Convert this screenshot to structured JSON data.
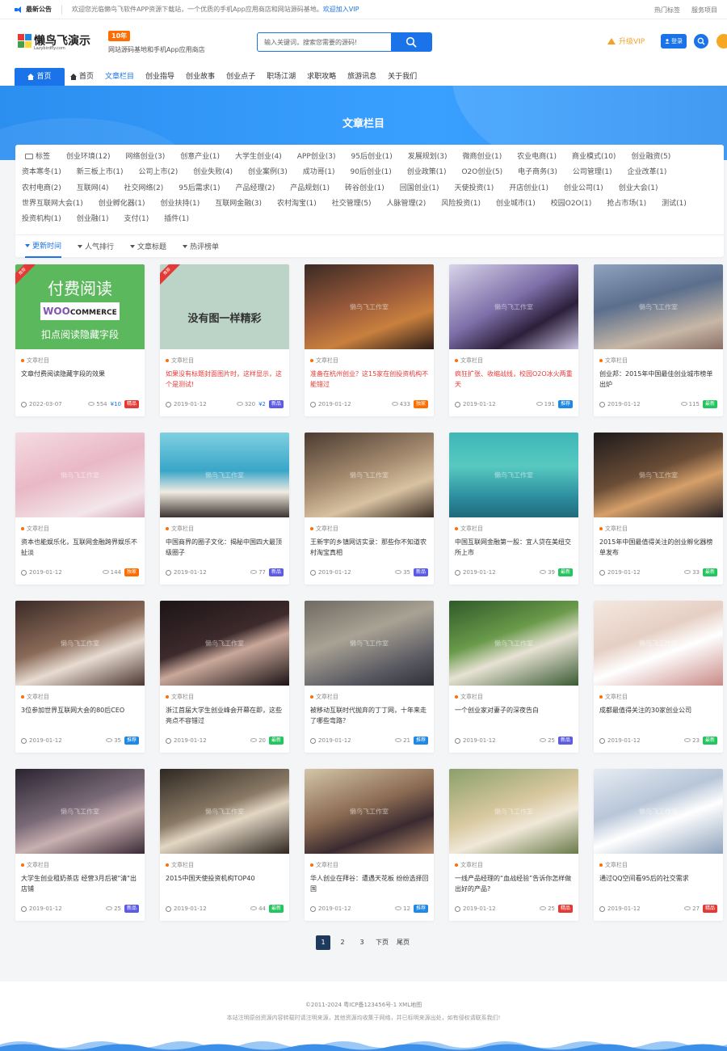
{
  "notice": {
    "title": "最新公告",
    "text": "欢迎您光临懒鸟飞软件APP资源下载站，一个优质的手机App应用商店和网站源码基地。",
    "link": "欢迎加入VIP",
    "right_links": [
      "热门标签",
      "服务项目"
    ]
  },
  "header": {
    "logo_text": "懒鸟飞演示",
    "logo_sub": "Lazybirdfly.com",
    "years_badge": "10年",
    "slogan": "网站源码基地和手机App应用商店",
    "search_placeholder": "输入关键词，搜索您需要的源码!",
    "vip_label": "升级VIP",
    "login_label": "登录"
  },
  "nav": {
    "items": [
      {
        "label": "首页",
        "home": true
      },
      {
        "label": "首页",
        "icon": true
      },
      {
        "label": "文章栏目",
        "active": true
      },
      {
        "label": "创业指导"
      },
      {
        "label": "创业故事"
      },
      {
        "label": "创业点子"
      },
      {
        "label": "职场江湖"
      },
      {
        "label": "求职攻略"
      },
      {
        "label": "旅游讯息"
      },
      {
        "label": "关于我们"
      }
    ]
  },
  "banner": {
    "title": "文章栏目"
  },
  "tags": {
    "head": "标签",
    "items": [
      "创业环境(12)",
      "网络创业(3)",
      "创意产业(1)",
      "大学生创业(4)",
      "APP创业(3)",
      "95后创业(1)",
      "发展规划(3)",
      "微商创业(1)",
      "农业电商(1)",
      "商业模式(10)",
      "创业融资(5)",
      "资本寒冬(1)",
      "新三板上市(1)",
      "公司上市(2)",
      "创业失败(4)",
      "创业案例(3)",
      "成功哥(1)",
      "90后创业(1)",
      "创业政策(1)",
      "O2O创业(5)",
      "电子商务(3)",
      "公司管理(1)",
      "企业改革(1)",
      "农村电商(2)",
      "互联网(4)",
      "社交网络(2)",
      "95后需求(1)",
      "产品经理(2)",
      "产品规划(1)",
      "砖谷创业(1)",
      "回国创业(1)",
      "天使投资(1)",
      "开店创业(1)",
      "创业公司(1)",
      "创业大会(1)",
      "世界互联网大会(1)",
      "创业孵化器(1)",
      "创业扶持(1)",
      "互联网金融(3)",
      "农村淘宝(1)",
      "社交管理(5)",
      "人脉管理(2)",
      "风险投资(1)",
      "创业城市(1)",
      "校园O2O(1)",
      "抢占市场(1)",
      "测试(1)",
      "投资机构(1)",
      "创业融(1)",
      "支付(1)",
      "插件(1)"
    ]
  },
  "sort": {
    "items": [
      {
        "label": "更新时间",
        "active": true
      },
      {
        "label": "人气排行"
      },
      {
        "label": "文章标题"
      },
      {
        "label": "热评榜单"
      }
    ]
  },
  "colors": {
    "primary": "#1a73e8",
    "badge_paid": "#e53935",
    "badge_exclusive": "#ff6d00",
    "badge_new": "#5b5be6",
    "badge_recommend": "#1e88e5",
    "badge_latest": "#22c55e"
  },
  "cards": [
    {
      "cat": "文章栏目",
      "title": "文章付费阅读隐藏字段的效果",
      "date": "2022-03-07",
      "views": "554",
      "price": "¥10",
      "badge": "精品",
      "badge_color": "#e53935",
      "red": false,
      "thumb": "woo",
      "ribbon": "推荐",
      "t1": "付费阅读",
      "t2": "扣点阅读隐藏字段",
      "bg": "#5cb85c"
    },
    {
      "cat": "文章栏目",
      "title": "如果没有标题封面图片时，这样显示，这个是测试!",
      "date": "2019-01-12",
      "views": "320",
      "price": "¥2",
      "badge": "新品",
      "badge_color": "#5b5be6",
      "red": true,
      "thumb": "noimg",
      "ribbon": "推荐",
      "t1": "没有图一样精彩",
      "bg": "#bcd3c8"
    },
    {
      "cat": "文章栏目",
      "title": "准备在杭州创业？这15家在创投资机构不能错过",
      "date": "2019-01-12",
      "views": "433",
      "badge": "独家",
      "badge_color": "#ff6d00",
      "red": true,
      "bg": "linear-gradient(160deg,#3b2a24,#9a5a3a 45%,#c9803e 70%,#2a1c18)"
    },
    {
      "cat": "文章栏目",
      "title": "疯狂扩张、收缩战线，校园O2O冰火两重天",
      "date": "2019-01-12",
      "views": "191",
      "badge": "推荐",
      "badge_color": "#1e88e5",
      "red": true,
      "bg": "linear-gradient(150deg,#d9d4ea,#7d6fa8 45%,#2b1f3a 70%,#c8c1e0)"
    },
    {
      "cat": "文章栏目",
      "title": "创业邦：2015年中国最佳创业城市榜单出炉",
      "date": "2019-01-12",
      "views": "115",
      "badge": "最新",
      "badge_color": "#22c55e",
      "red": false,
      "bg": "linear-gradient(165deg,#8fa3bf,#5b6f8d 40%,#c7b7a6 75%,#8a6f66)"
    },
    {
      "cat": "文章栏目",
      "title": "资本也能娱乐化，互联网金融跨界娱乐不扯淡",
      "date": "2019-01-12",
      "views": "144",
      "badge": "独家",
      "badge_color": "#ff6d00",
      "red": false,
      "bg": "linear-gradient(160deg,#f5dbe2,#e9b8c6 45%,#f3e6ea 80%,#d9a8b8)"
    },
    {
      "cat": "文章栏目",
      "title": "中国商界的圈子文化：揭秘中国四大最顶级圈子",
      "date": "2019-01-12",
      "views": "77",
      "badge": "新品",
      "badge_color": "#5b5be6",
      "red": false,
      "bg": "linear-gradient(180deg,#7fd0e0,#39a6c8 45%,#f1ece1 70%,#3b3330)"
    },
    {
      "cat": "文章栏目",
      "title": "王新宇的乡镇网访实录：那些你不知道农村淘宝真相",
      "date": "2019-01-12",
      "views": "35",
      "badge": "新品",
      "badge_color": "#5b5be6",
      "red": false,
      "bg": "linear-gradient(160deg,#4a3a30,#a48a6e 45%,#d8c2a1 70%,#3a2c24)"
    },
    {
      "cat": "文章栏目",
      "title": "中国互联网金融第一股：宜人贷在美纽交所上市",
      "date": "2019-01-12",
      "views": "39",
      "badge": "最新",
      "badge_color": "#22c55e",
      "red": false,
      "bg": "linear-gradient(180deg,#3fb6b7,#57c9c0 40%,#2d8fa0 75%,#1f6a7a)"
    },
    {
      "cat": "文章栏目",
      "title": "2015年中国最值得关注的创业孵化器榜单发布",
      "date": "2019-01-12",
      "views": "33",
      "badge": "最新",
      "badge_color": "#22c55e",
      "red": false,
      "bg": "linear-gradient(160deg,#1e1a1c,#6a4d36 45%,#d6a06a 65%,#2a2226)"
    },
    {
      "cat": "文章栏目",
      "title": "3位参加世界互联网大会的80后CEO",
      "date": "2019-01-12",
      "views": "35",
      "badge": "推荐",
      "badge_color": "#1e88e5",
      "red": false,
      "bg": "linear-gradient(160deg,#3a2a26,#8a6a58 45%,#e8dcd2 65%,#4a3630)"
    },
    {
      "cat": "文章栏目",
      "title": "浙江首届大学生创业峰会开幕在即，这些亮点不容错过",
      "date": "2019-01-12",
      "views": "20",
      "badge": "最新",
      "badge_color": "#22c55e",
      "red": false,
      "bg": "linear-gradient(160deg,#1c1416,#3d2a2c 45%,#c9a89a 60%,#1a1214)"
    },
    {
      "cat": "文章栏目",
      "title": "被移动互联时代抛弃的丁丁网，十年来走了哪些弯路？",
      "date": "2019-01-12",
      "views": "21",
      "badge": "推荐",
      "badge_color": "#1e88e5",
      "red": false,
      "bg": "linear-gradient(160deg,#6e6a62,#a9a294 40%,#5a5a62 75%,#2f2f36)"
    },
    {
      "cat": "文章栏目",
      "title": "一个创业家对妻子的深夜告白",
      "date": "2019-01-12",
      "views": "25",
      "badge": "新品",
      "badge_color": "#5b5be6",
      "red": false,
      "bg": "linear-gradient(160deg,#2f5a2a,#6a9a4a 40%,#e7e2d4 60%,#3a5a32)"
    },
    {
      "cat": "文章栏目",
      "title": "成都最值得关注的30家创业公司",
      "date": "2019-01-12",
      "views": "23",
      "badge": "最新",
      "badge_color": "#22c55e",
      "red": false,
      "bg": "linear-gradient(160deg,#f3e9e0,#e6cfc4 40%,#ffffff 60%,#c98a86)"
    },
    {
      "cat": "文章栏目",
      "title": "大学生创业租奶茶店 经营3月后被\"清\"出店铺",
      "date": "2019-01-12",
      "views": "25",
      "badge": "新品",
      "badge_color": "#5b5be6",
      "red": false,
      "bg": "linear-gradient(160deg,#2a2430,#7a6a78 45%,#c9b0b0 65%,#3a2a36)"
    },
    {
      "cat": "文章栏目",
      "title": "2015中国天使投资机构TOP40",
      "date": "2019-01-12",
      "views": "44",
      "badge": "最新",
      "badge_color": "#22c55e",
      "red": false,
      "bg": "linear-gradient(160deg,#2e2822,#8a7a66 45%,#e3d7c4 60%,#2e2620)"
    },
    {
      "cat": "文章栏目",
      "title": "华人创业在拜谷：遭遇天花板 纷纷选择回国",
      "date": "2019-01-12",
      "views": "12",
      "badge": "推荐",
      "badge_color": "#1e88e5",
      "red": false,
      "bg": "linear-gradient(160deg,#d4c6a8,#8a6a52 45%,#3a2a30 70%,#b58a6a)"
    },
    {
      "cat": "文章栏目",
      "title": "一线产品经理的“血战经验”告诉你怎样做出好的产品?",
      "date": "2019-01-12",
      "views": "25",
      "badge": "精品",
      "badge_color": "#e53935",
      "red": false,
      "bg": "linear-gradient(160deg,#8aa06a,#d8c8a0 45%,#f0e8d8 65%,#6a7a4a)"
    },
    {
      "cat": "文章栏目",
      "title": "通过QQ空间看95后的社交需求",
      "date": "2019-01-12",
      "views": "27",
      "badge": "精品",
      "badge_color": "#e53935",
      "red": false,
      "bg": "linear-gradient(160deg,#e6ecf3,#b8c6d8 40%,#ffffff 60%,#8ea2bc)"
    }
  ],
  "watermark": "懒鸟飞工作室",
  "pager": {
    "pages": [
      "1",
      "2",
      "3"
    ],
    "next": "下页",
    "last": "尾页"
  },
  "footer": {
    "line1": "©2011-2024   粤ICP备123456号-1   XML地图",
    "line2": "本站注明原创资源内容转载时请注明来源，其他资源均收集于网络，并已标明来源出处，如有侵权请联系我们!"
  }
}
